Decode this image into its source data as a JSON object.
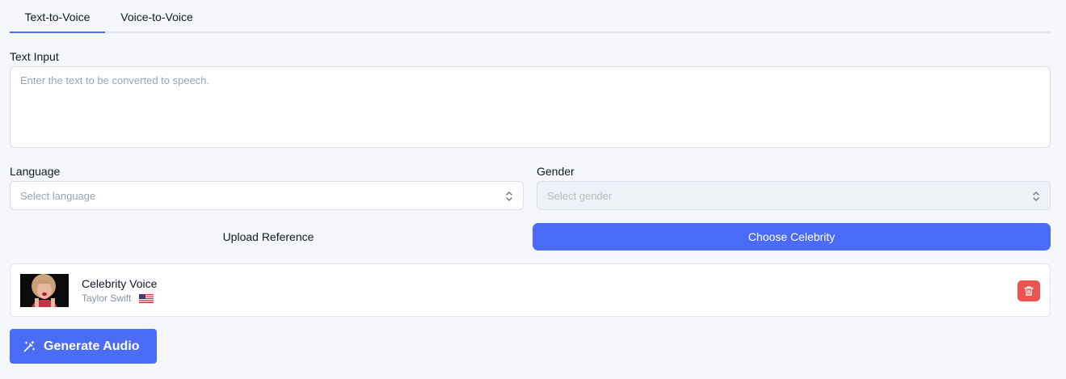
{
  "tabs": [
    {
      "label": "Text-to-Voice",
      "active": true
    },
    {
      "label": "Voice-to-Voice",
      "active": false
    }
  ],
  "text_input": {
    "label": "Text Input",
    "placeholder": "Enter the text to be converted to speech.",
    "value": ""
  },
  "language": {
    "label": "Language",
    "placeholder": "Select language"
  },
  "gender": {
    "label": "Gender",
    "placeholder": "Select gender",
    "disabled": true
  },
  "source_buttons": {
    "upload_label": "Upload Reference",
    "celebrity_label": "Choose Celebrity",
    "selected": "celebrity"
  },
  "voice_card": {
    "title": "Celebrity Voice",
    "name": "Taylor Swift",
    "flag": "us-flag-icon",
    "delete_icon": "trash-icon"
  },
  "generate": {
    "label": "Generate Audio",
    "icon": "magic-wand-icon"
  },
  "colors": {
    "accent": "#4a6cf7",
    "danger": "#ef5350",
    "background": "#f5f7fb"
  }
}
